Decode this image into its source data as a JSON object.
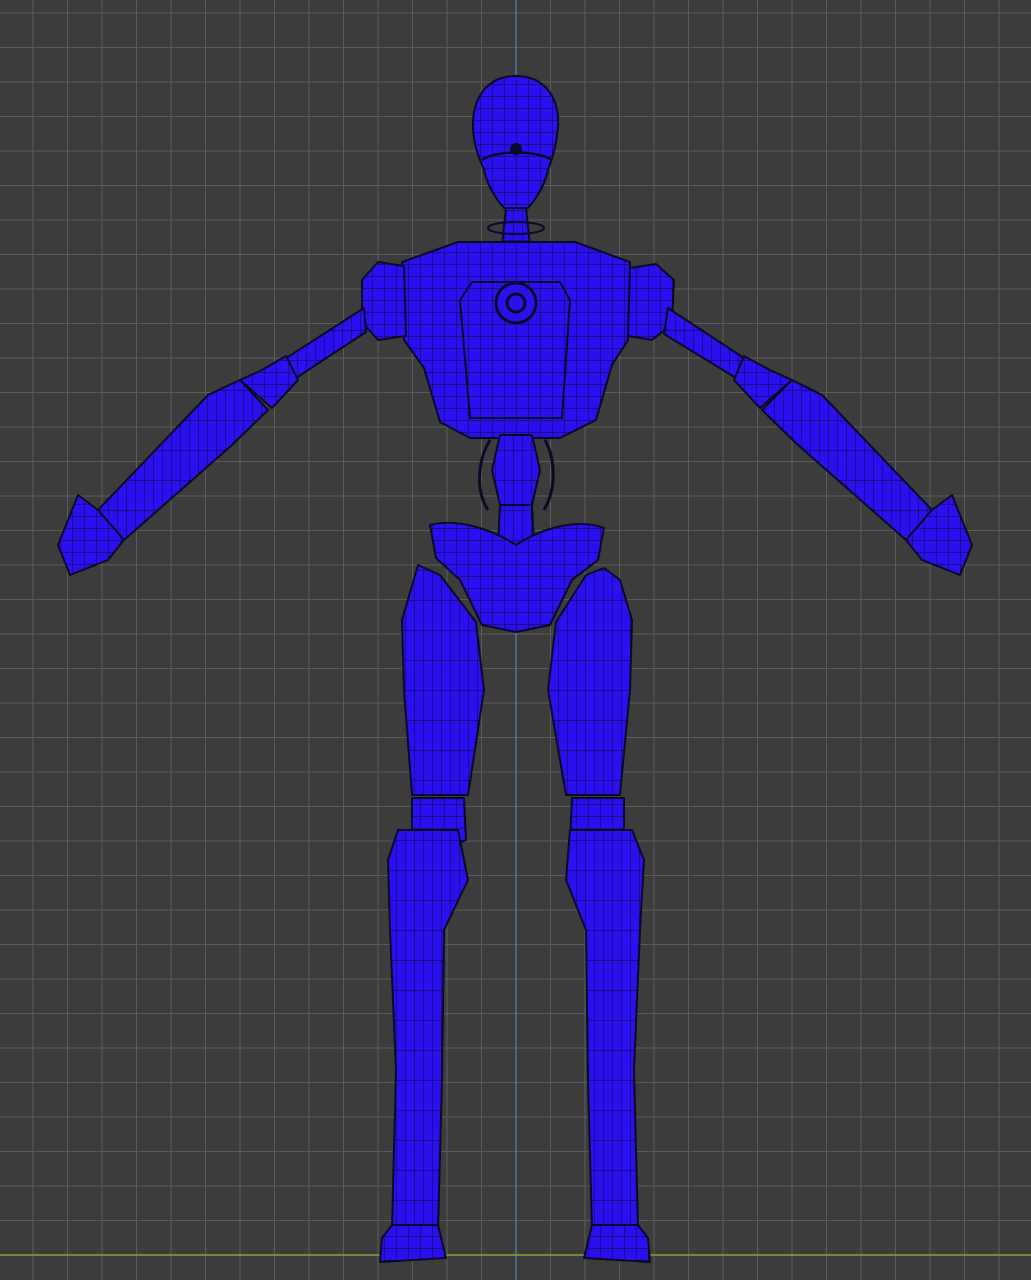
{
  "viewport": {
    "view": "front-orthographic",
    "grid": true,
    "background_color": "#3c3c3c",
    "grid_minor_color": "#4f4f4f",
    "grid_major_color": "#5b5b5b",
    "axis_z_color": "#5a8fc8",
    "axis_y_color": "#7fa33a"
  },
  "model": {
    "subject": "robot-character-t-pose",
    "display_mode": "wireframe-on-solid",
    "fill_color": "#2a10ee",
    "wire_color": "#0a0a26",
    "parts": [
      "head",
      "neck",
      "torso",
      "chest-port",
      "spine",
      "pelvis",
      "left-upper-arm",
      "left-forearm",
      "left-hand",
      "right-upper-arm",
      "right-forearm",
      "right-hand",
      "left-thigh",
      "left-knee",
      "left-shin",
      "left-foot",
      "right-thigh",
      "right-knee",
      "right-shin",
      "right-foot"
    ]
  }
}
